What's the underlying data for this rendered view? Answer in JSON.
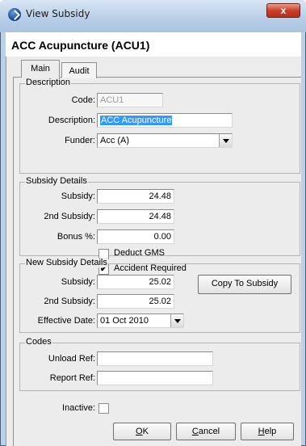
{
  "window": {
    "title": "View Subsidy",
    "close_glyph": "x"
  },
  "header": {
    "title": "ACC Acupuncture (ACU1)"
  },
  "tabs": [
    {
      "label": "Main"
    },
    {
      "label": "Audit"
    }
  ],
  "description": {
    "legend": "Description",
    "code_label": "Code:",
    "code_value": "ACU1",
    "description_label": "Description:",
    "description_value": "ACC Acupuncture",
    "funder_label": "Funder:",
    "funder_value": "Acc (A)"
  },
  "subsidy_details": {
    "legend": "Subsidy Details",
    "subsidy_label": "Subsidy:",
    "subsidy_value": "24.48",
    "second_label": "2nd Subsidy:",
    "second_value": "24.48",
    "bonus_label": "Bonus %:",
    "bonus_value": "0.00",
    "deduct_gms_label": "Deduct GMS",
    "deduct_gms_checked": false,
    "accident_label": "Accident Required",
    "accident_checked": true,
    "check_glyph": "✔"
  },
  "new_subsidy_details": {
    "legend": "New Subsidy Details",
    "subsidy_label": "Subsidy:",
    "subsidy_value": "25.02",
    "second_label": "2nd Subsidy:",
    "second_value": "25.02",
    "effective_label": "Effective Date:",
    "effective_value": "01 Oct 2010",
    "copy_button": "Copy To Subsidy"
  },
  "codes": {
    "legend": "Codes",
    "unload_label": "Unload Ref:",
    "unload_value": "",
    "report_label": "Report Ref:",
    "report_value": ""
  },
  "inactive": {
    "label": "Inactive:",
    "checked": false
  },
  "buttons": {
    "ok_mnemonic": "O",
    "ok_rest": "K",
    "cancel_mnemonic": "C",
    "cancel_rest": "ancel",
    "help_mnemonic": "H",
    "help_rest": "elp"
  },
  "colors": {
    "selection": "#3399ff",
    "close": "#c8402a",
    "title_gradient": "#b9cfe8"
  }
}
